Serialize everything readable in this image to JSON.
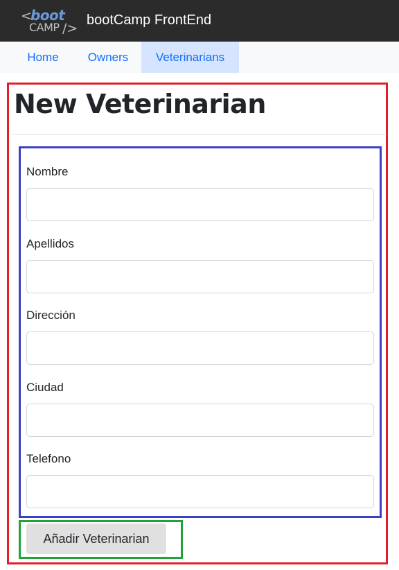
{
  "header": {
    "logo": {
      "prefix": "<",
      "word_top": "boot",
      "word_bottom": "CAMP",
      "suffix": "/>"
    },
    "title": "bootCamp FrontEnd"
  },
  "nav": {
    "items": [
      {
        "label": "Home",
        "active": false
      },
      {
        "label": "Owners",
        "active": false
      },
      {
        "label": "Veterinarians",
        "active": true
      }
    ]
  },
  "page": {
    "title": "New Veterinarian"
  },
  "form": {
    "fields": [
      {
        "label": "Nombre",
        "value": ""
      },
      {
        "label": "Apellidos",
        "value": ""
      },
      {
        "label": "Dirección",
        "value": ""
      },
      {
        "label": "Ciudad",
        "value": ""
      },
      {
        "label": "Telefono",
        "value": ""
      }
    ],
    "submit_label": "Añadir Veterinarian"
  },
  "colors": {
    "topbar_bg": "#2b2b2b",
    "nav_bg": "#f8f9fa",
    "nav_active_bg": "#d6e4ff",
    "link": "#0d6efd",
    "outline_red": "#e01f2b",
    "outline_blue": "#3b3fc4",
    "outline_green": "#21a33a",
    "button_bg": "#e0e0e0"
  }
}
